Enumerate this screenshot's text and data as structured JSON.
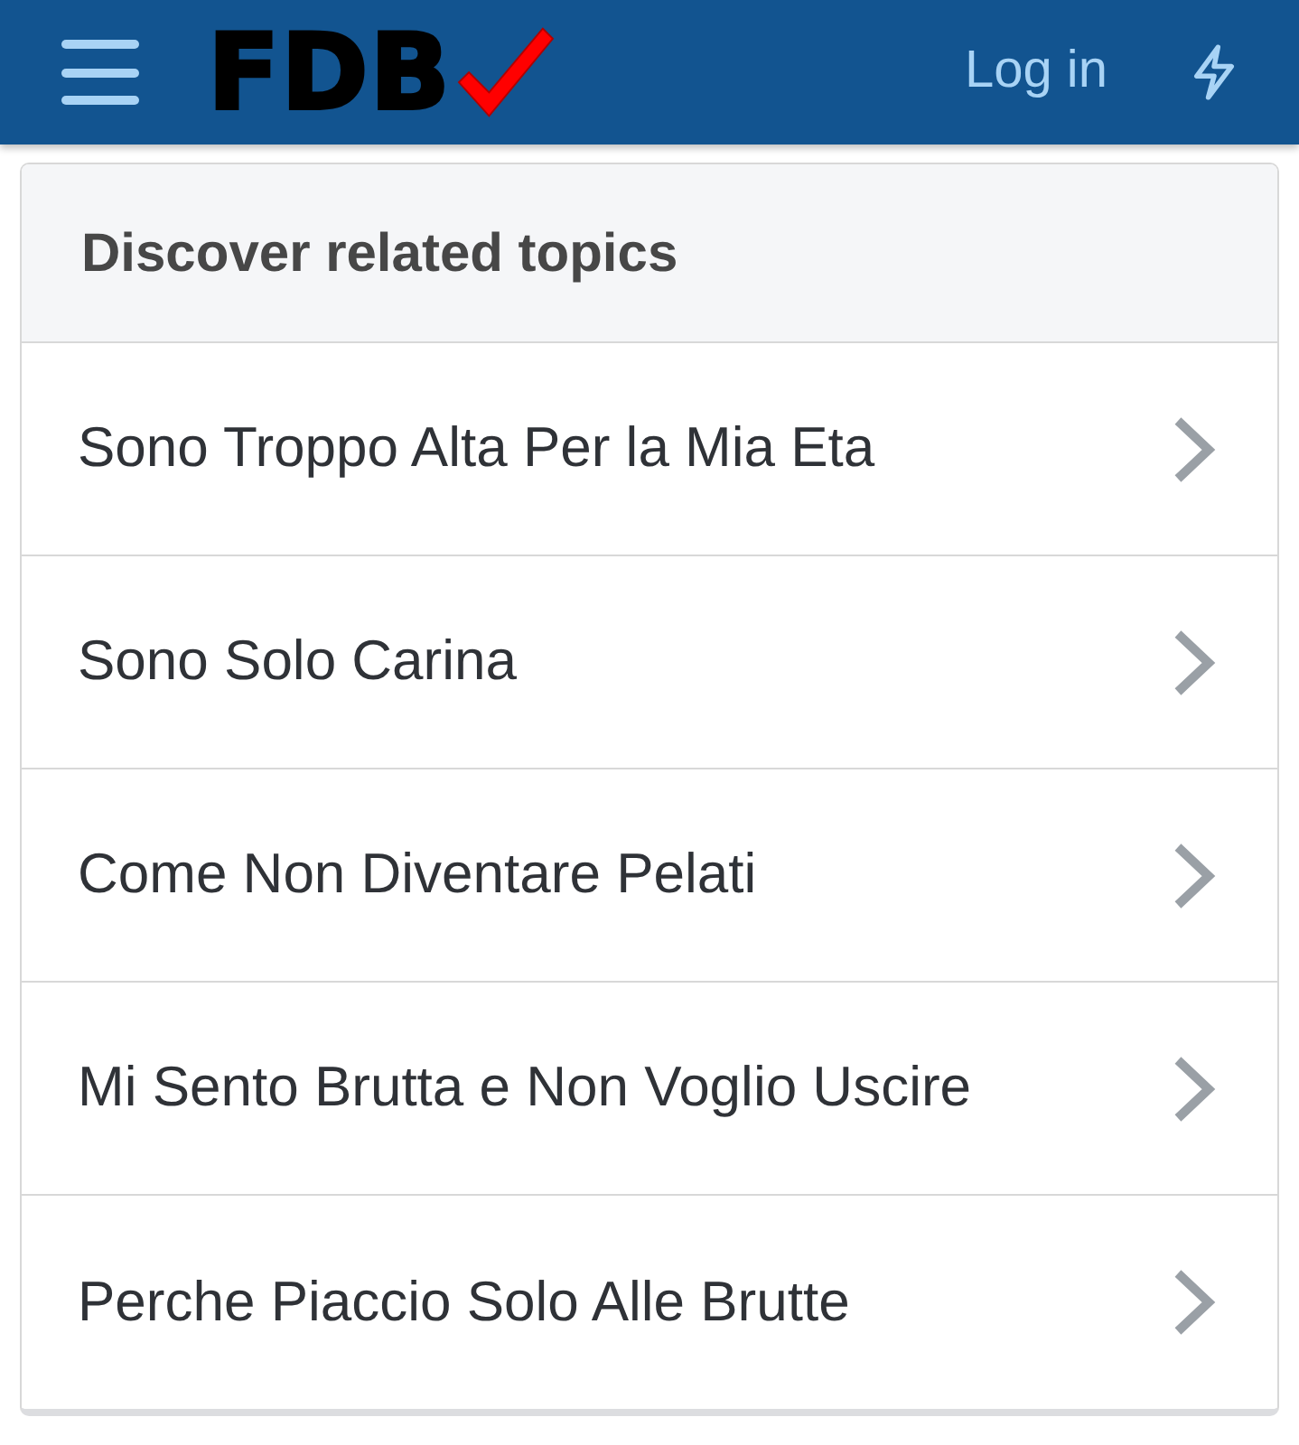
{
  "header": {
    "logo": "FDB",
    "login": "Log in"
  },
  "related": {
    "title": "Discover related topics",
    "items": [
      {
        "label": "Sono Troppo Alta Per la Mia Eta"
      },
      {
        "label": "Sono Solo Carina"
      },
      {
        "label": "Come Non Diventare Pelati"
      },
      {
        "label": "Mi Sento Brutta e Non Voglio Uscire"
      },
      {
        "label": "Perche Piaccio Solo Alle Brutte"
      }
    ]
  }
}
